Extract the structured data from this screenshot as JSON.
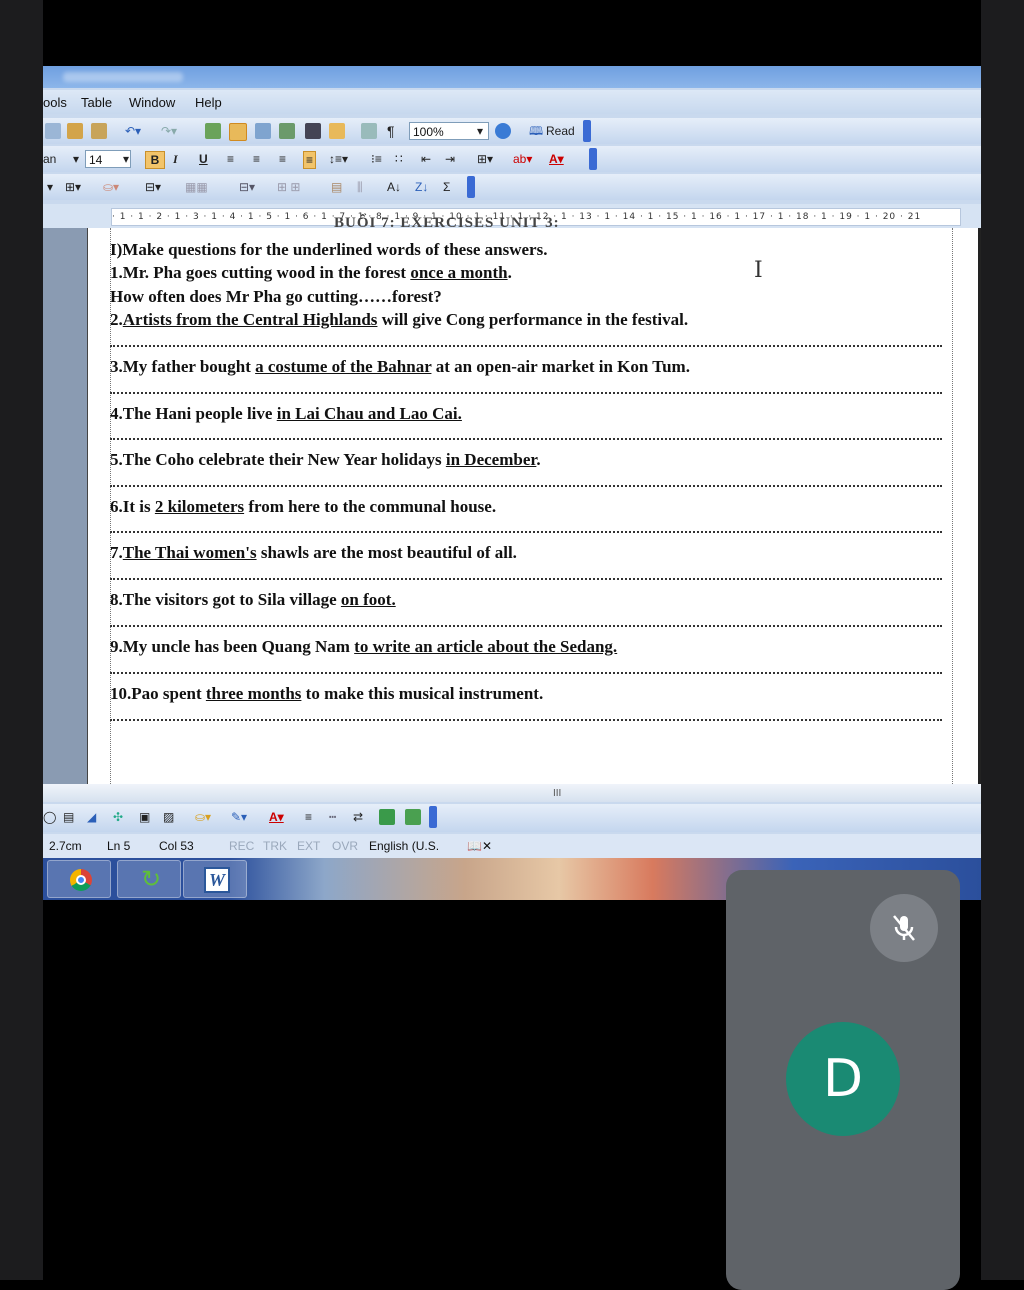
{
  "menu": {
    "tools_partial": "ools",
    "table": "Table",
    "window": "Window",
    "help": "Help"
  },
  "toolbar": {
    "zoom": "100%",
    "read_label": "Read",
    "font_partial": "an",
    "font_size": "14",
    "bold": "B",
    "italic": "I",
    "underline": "U",
    "pilcrow": "¶"
  },
  "ruler": {
    "scale": "· 1 · 1 · 2 · 1 · 3 · 1 · 4 · 1 · 5 · 1 · 6 · 1 · 7 · 1 · 8 · 1 · 9 · 1 · 10 · 1 · 11 · 1 · 12 · 1 · 13 · 1 · 14 · 1 · 15 · 1 · 16 · 1 · 17 · 1 · 18 · 1 · 19 · 1 · 20 · 21"
  },
  "document": {
    "heading_cut": "BUỔI 7:            EXERCISES   UNIT 3:",
    "instruction": "I)Make questions for the underlined words of these answers.",
    "q1": {
      "pre": "1.Mr. Pha goes cutting wood in the forest ",
      "u": "once a month",
      "post": "."
    },
    "q1_answer": "How often  does Mr Pha go cutting……forest?",
    "q2": {
      "pre": "2.",
      "u": "Artists from the Central Highlands",
      "post": " will give Cong performance in the festival."
    },
    "q3": {
      "pre": "3.My father bought ",
      "u": "a costume of the Bahnar",
      "post": " at an open-air market in Kon Tum."
    },
    "q4": {
      "pre": "4.The Hani people live ",
      "u": "in Lai Chau and Lao Cai.",
      "post": ""
    },
    "q5": {
      "pre": "5.The Coho celebrate their New Year holidays ",
      "u": "in December",
      "post": "."
    },
    "q6": {
      "pre": "6.It is ",
      "u": "2 kilometers",
      "post": " from here to the communal house."
    },
    "q7": {
      "pre": "7.",
      "u": "The Thai women's",
      "post": " shawls are the most beautiful of all."
    },
    "q8": {
      "pre": "8.The visitors got to Sila village ",
      "u": "on foot.",
      "post": ""
    },
    "q9": {
      "pre": "9.My uncle has been Quang Nam ",
      "u": "to write an article about the Sedang.",
      "post": ""
    },
    "q10": {
      "pre": "10.Pao spent ",
      "u": "three months",
      "post": " to make this musical instrument."
    }
  },
  "scroll": {
    "thumb": "III"
  },
  "status": {
    "position": "2.7cm",
    "line": "Ln 5",
    "col": "Col 53",
    "rec": "REC",
    "trk": "TRK",
    "ext": "EXT",
    "ovr": "OVR",
    "language": "English (U.S."
  },
  "call": {
    "avatar_letter": "D",
    "mic_state": "muted"
  },
  "colors": {
    "avatar_bg": "#1a8a73",
    "tile_bg": "#5f6368",
    "page_bg": "#ffffff"
  }
}
